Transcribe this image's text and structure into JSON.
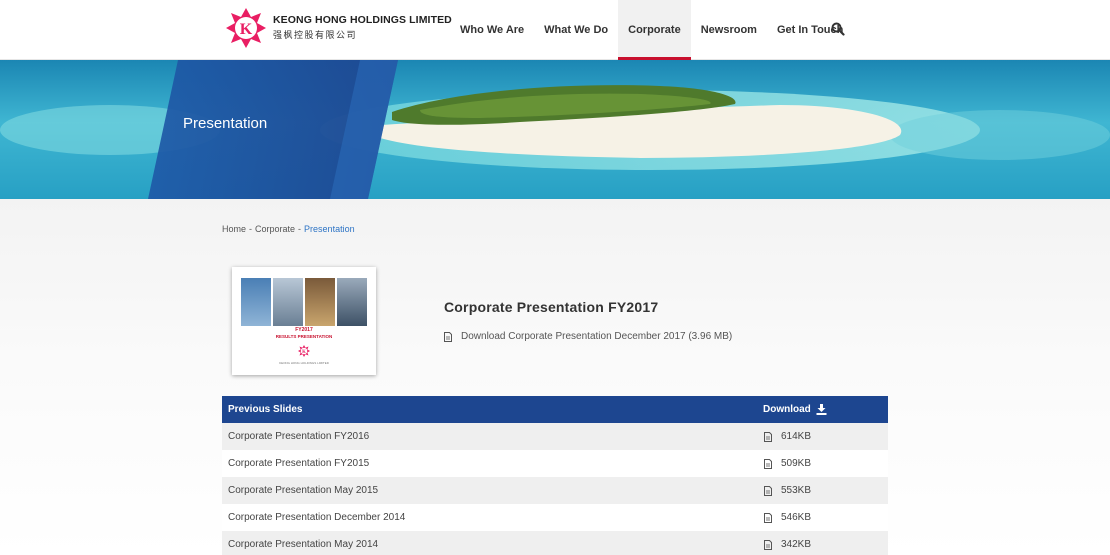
{
  "brand": {
    "name_en": "KEONG HONG HOLDINGS LIMITED",
    "name_zh": "强枫控股有限公司",
    "accent": "#e91e63"
  },
  "nav": {
    "items": [
      {
        "label": "Who We Are",
        "active": false
      },
      {
        "label": "What We Do",
        "active": false
      },
      {
        "label": "Corporate",
        "active": true
      },
      {
        "label": "Newsroom",
        "active": false
      },
      {
        "label": "Get In Touch",
        "active": false
      }
    ],
    "search_icon": "search-icon"
  },
  "banner": {
    "title": "Presentation"
  },
  "breadcrumb": {
    "home": "Home",
    "section": "Corporate",
    "current": "Presentation",
    "separator": "-"
  },
  "featured": {
    "thumb_line1": "FY2017",
    "thumb_line2": "RESULTS PRESENTATION",
    "thumb_company": "KEONG HONG HOLDINGS LIMITED",
    "title": "Corporate Presentation FY2017",
    "download_text": "Download Corporate Presentation December 2017 (3.96 MB)"
  },
  "table": {
    "header_name": "Previous Slides",
    "header_download": "Download",
    "rows": [
      {
        "name": "Corporate Presentation FY2016",
        "size": "614KB"
      },
      {
        "name": "Corporate Presentation FY2015",
        "size": "509KB"
      },
      {
        "name": "Corporate Presentation May 2015",
        "size": "553KB"
      },
      {
        "name": "Corporate Presentation December 2014",
        "size": "546KB"
      },
      {
        "name": "Corporate Presentation May 2014",
        "size": "342KB"
      }
    ]
  },
  "colors": {
    "primary_blue": "#1d4690",
    "active_red": "#c8102e",
    "link_blue": "#2e74c5"
  }
}
